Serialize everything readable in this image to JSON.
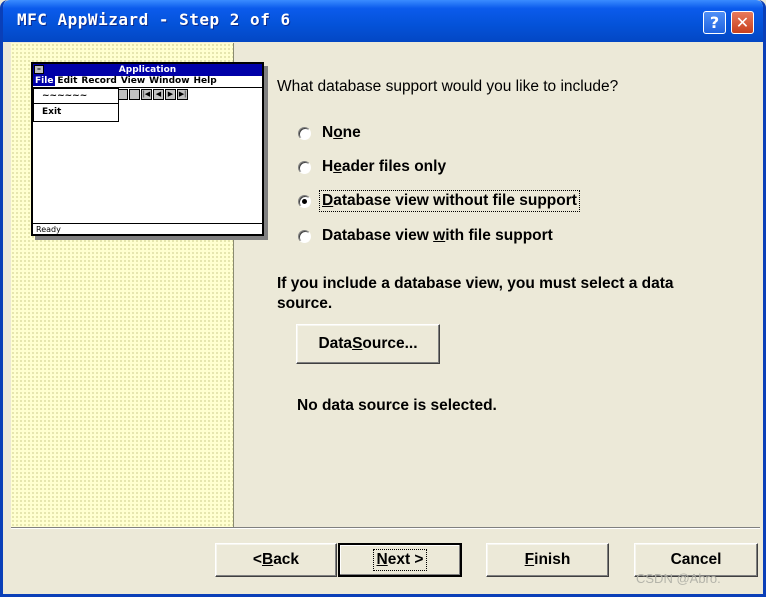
{
  "window": {
    "title": "MFC AppWizard - Step 2 of 6",
    "help_glyph": "?",
    "close_glyph": "✕"
  },
  "preview": {
    "app_title": "Application",
    "system_menu_glyph": "–",
    "menu": [
      "File",
      "Edit",
      "Record",
      "View",
      "Window",
      "Help"
    ],
    "dropdown_item1": "~~~~~~",
    "dropdown_item2": "Exit",
    "toolbar_glyphs": [
      "",
      "",
      "|◀",
      "◀",
      "▶",
      "▶|"
    ],
    "status": "Ready"
  },
  "question": "What database support would you like to include?",
  "options": [
    {
      "pre": "N",
      "ul": "o",
      "post": "ne",
      "checked": false
    },
    {
      "pre": "H",
      "ul": "e",
      "post": "ader files only",
      "checked": false
    },
    {
      "pre": "",
      "ul": "D",
      "post": "atabase view without file support",
      "checked": true
    },
    {
      "pre": "Database view ",
      "ul": "w",
      "post": "ith file support",
      "checked": false
    }
  ],
  "info_text": "If you include a database view, you must select a data source.",
  "data_source_button": {
    "pre": "Data ",
    "ul": "S",
    "post": "ource..."
  },
  "data_source_status": "No data source is selected.",
  "footer": {
    "back": {
      "prefix": "< ",
      "ul": "B",
      "post": "ack"
    },
    "next": {
      "ul": "N",
      "post": "ext >"
    },
    "finish": {
      "ul": "F",
      "post": "inish"
    },
    "cancel": "Cancel"
  },
  "watermark": "CSDN @Abro."
}
